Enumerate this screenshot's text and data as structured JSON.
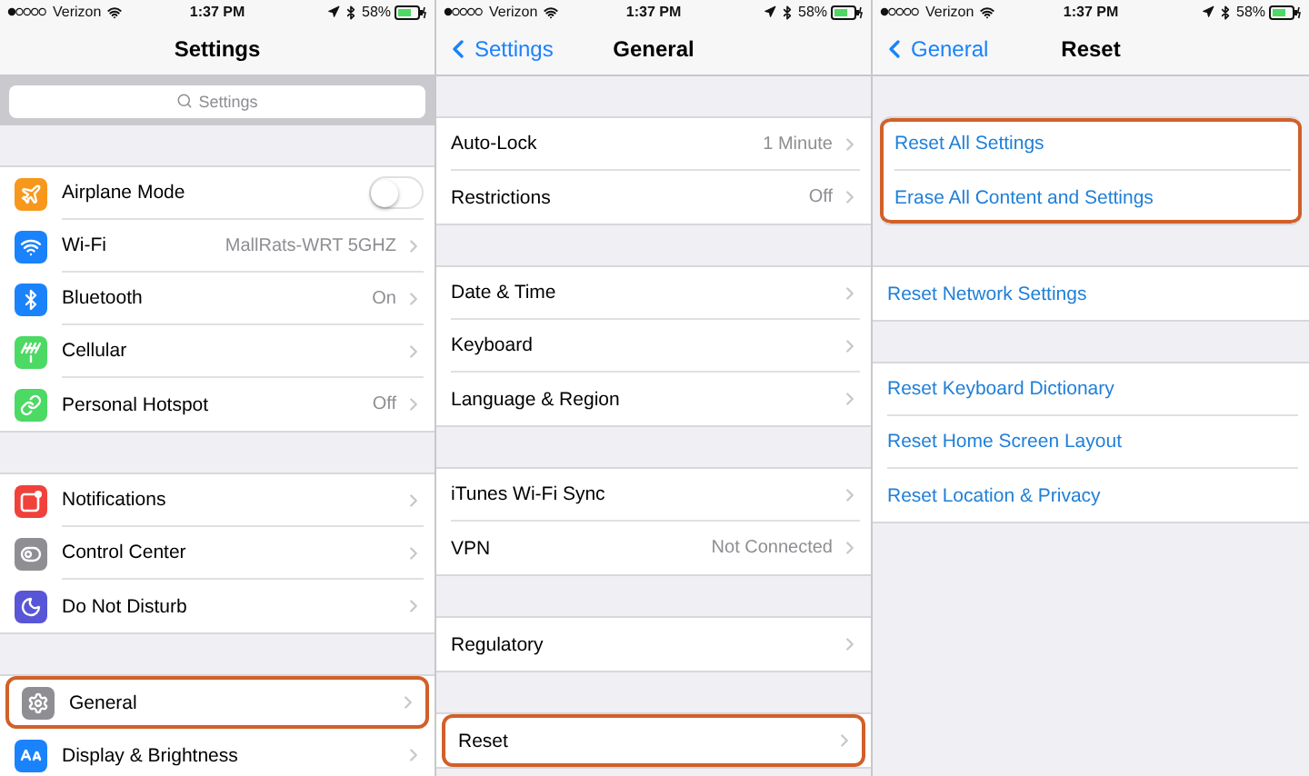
{
  "panels": [
    {
      "status": {
        "carrier": "Verizon",
        "time": "1:37 PM",
        "battery": "58%"
      },
      "nav": {
        "title": "Settings"
      },
      "search": {
        "placeholder": "Settings"
      },
      "groups": [
        {
          "highlighted": false,
          "rows": [
            {
              "kind": "toggle",
              "label": "Airplane Mode",
              "on": false,
              "color": "#f7981c",
              "highlighted": false
            },
            {
              "kind": "nav",
              "label": "Wi-Fi",
              "value": "MallRats-WRT 5GHZ",
              "color": "#1a82fb",
              "highlighted": false
            },
            {
              "kind": "nav",
              "label": "Bluetooth",
              "value": "On",
              "color": "#1a82fb",
              "highlighted": false
            },
            {
              "kind": "nav",
              "label": "Cellular",
              "color": "#4cd964",
              "highlighted": false
            },
            {
              "kind": "nav",
              "label": "Personal Hotspot",
              "value": "Off",
              "color": "#4cd964",
              "highlighted": false
            }
          ]
        },
        {
          "highlighted": false,
          "rows": [
            {
              "kind": "nav",
              "label": "Notifications",
              "color": "#f0413b",
              "highlighted": false
            },
            {
              "kind": "nav",
              "label": "Control Center",
              "color": "#8e8e93",
              "highlighted": false
            },
            {
              "kind": "nav",
              "label": "Do Not Disturb",
              "color": "#5856d6",
              "highlighted": false
            }
          ]
        },
        {
          "highlighted": false,
          "rows": [
            {
              "kind": "nav",
              "label": "General",
              "color": "#8e8e93",
              "highlighted": true
            },
            {
              "kind": "nav",
              "label": "Display & Brightness",
              "color": "#1a82fb",
              "highlighted": false
            }
          ]
        }
      ]
    },
    {
      "status": {
        "carrier": "Verizon",
        "time": "1:37 PM",
        "battery": "58%"
      },
      "nav": {
        "back": "Settings",
        "title": "General"
      },
      "groups": [
        {
          "highlighted": false,
          "rows": [
            {
              "kind": "nav",
              "label": "Auto-Lock",
              "value": "1 Minute",
              "highlighted": false
            },
            {
              "kind": "nav",
              "label": "Restrictions",
              "value": "Off",
              "highlighted": false
            }
          ]
        },
        {
          "highlighted": false,
          "rows": [
            {
              "kind": "nav",
              "label": "Date & Time",
              "highlighted": false
            },
            {
              "kind": "nav",
              "label": "Keyboard",
              "highlighted": false
            },
            {
              "kind": "nav",
              "label": "Language & Region",
              "highlighted": false
            }
          ]
        },
        {
          "highlighted": false,
          "rows": [
            {
              "kind": "nav",
              "label": "iTunes Wi-Fi Sync",
              "highlighted": false
            },
            {
              "kind": "nav",
              "label": "VPN",
              "value": "Not Connected",
              "highlighted": false
            }
          ]
        },
        {
          "highlighted": false,
          "rows": [
            {
              "kind": "nav",
              "label": "Regulatory",
              "highlighted": false
            }
          ]
        },
        {
          "highlighted": false,
          "rows": [
            {
              "kind": "nav",
              "label": "Reset",
              "highlighted": true
            }
          ]
        }
      ]
    },
    {
      "status": {
        "carrier": "Verizon",
        "time": "1:37 PM",
        "battery": "58%"
      },
      "nav": {
        "back": "General",
        "title": "Reset"
      },
      "groups": [
        {
          "highlighted": true,
          "rows": [
            {
              "kind": "action",
              "label": "Reset All Settings",
              "highlighted": false
            },
            {
              "kind": "action",
              "label": "Erase All Content and Settings",
              "highlighted": false
            }
          ]
        },
        {
          "highlighted": false,
          "rows": [
            {
              "kind": "action",
              "label": "Reset Network Settings",
              "highlighted": false
            }
          ]
        },
        {
          "highlighted": false,
          "rows": [
            {
              "kind": "action",
              "label": "Reset Keyboard Dictionary",
              "highlighted": false
            },
            {
              "kind": "action",
              "label": "Reset Home Screen Layout",
              "highlighted": false
            },
            {
              "kind": "action",
              "label": "Reset Location & Privacy",
              "highlighted": false
            }
          ]
        }
      ]
    }
  ]
}
